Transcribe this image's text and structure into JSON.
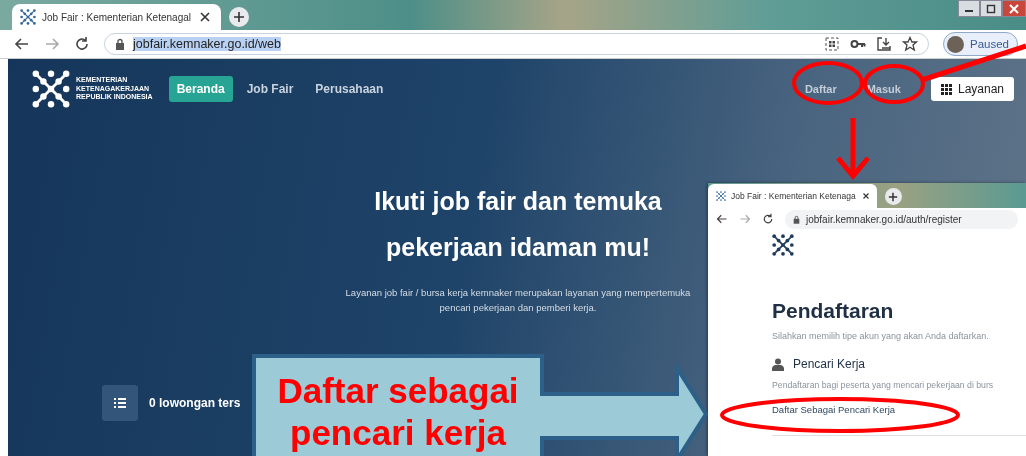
{
  "browser": {
    "tab_title": "Job Fair : Kementerian Ketenagal",
    "url": "jobfair.kemnaker.go.id/web",
    "profile_label": "Paused"
  },
  "site": {
    "logo_lines": [
      "KEMENTERIAN",
      "KETENAGAKERJAAN",
      "REPUBLIK INDONESIA"
    ],
    "nav": [
      {
        "label": "Beranda",
        "selected": true
      },
      {
        "label": "Job Fair",
        "selected": false
      },
      {
        "label": "Perusahaan",
        "selected": false
      }
    ],
    "auth_links": [
      "Daftar",
      "Masuk"
    ],
    "services_button": "Layanan",
    "hero_title_lines": [
      "Ikuti job fair dan temuka",
      "pekerjaan idaman mu!"
    ],
    "hero_text_lines": [
      "Layanan job fair / bursa kerja kemnaker merupakan layanan yang mempertemuka",
      "pencari pekerjaan dan pemberi kerja."
    ],
    "vacancy_count": "0 lowongan ters"
  },
  "inset": {
    "tab_title": "Job Fair : Kementerian Ketenaga",
    "url": "jobfair.kemnaker.go.id/auth/register",
    "heading": "Pendaftaran",
    "subtitle": "Silahkan memilih tipe akun yang akan Anda daftarkan.",
    "section_title": "Pencari Kerja",
    "section_text": "Pendaftaran bagi peserta yang mencari pekerjaan di burs",
    "link": "Daftar Sebagai Pencari Kerja"
  },
  "callout": {
    "lines": [
      "Daftar sebagai",
      "pencari kerja"
    ]
  }
}
